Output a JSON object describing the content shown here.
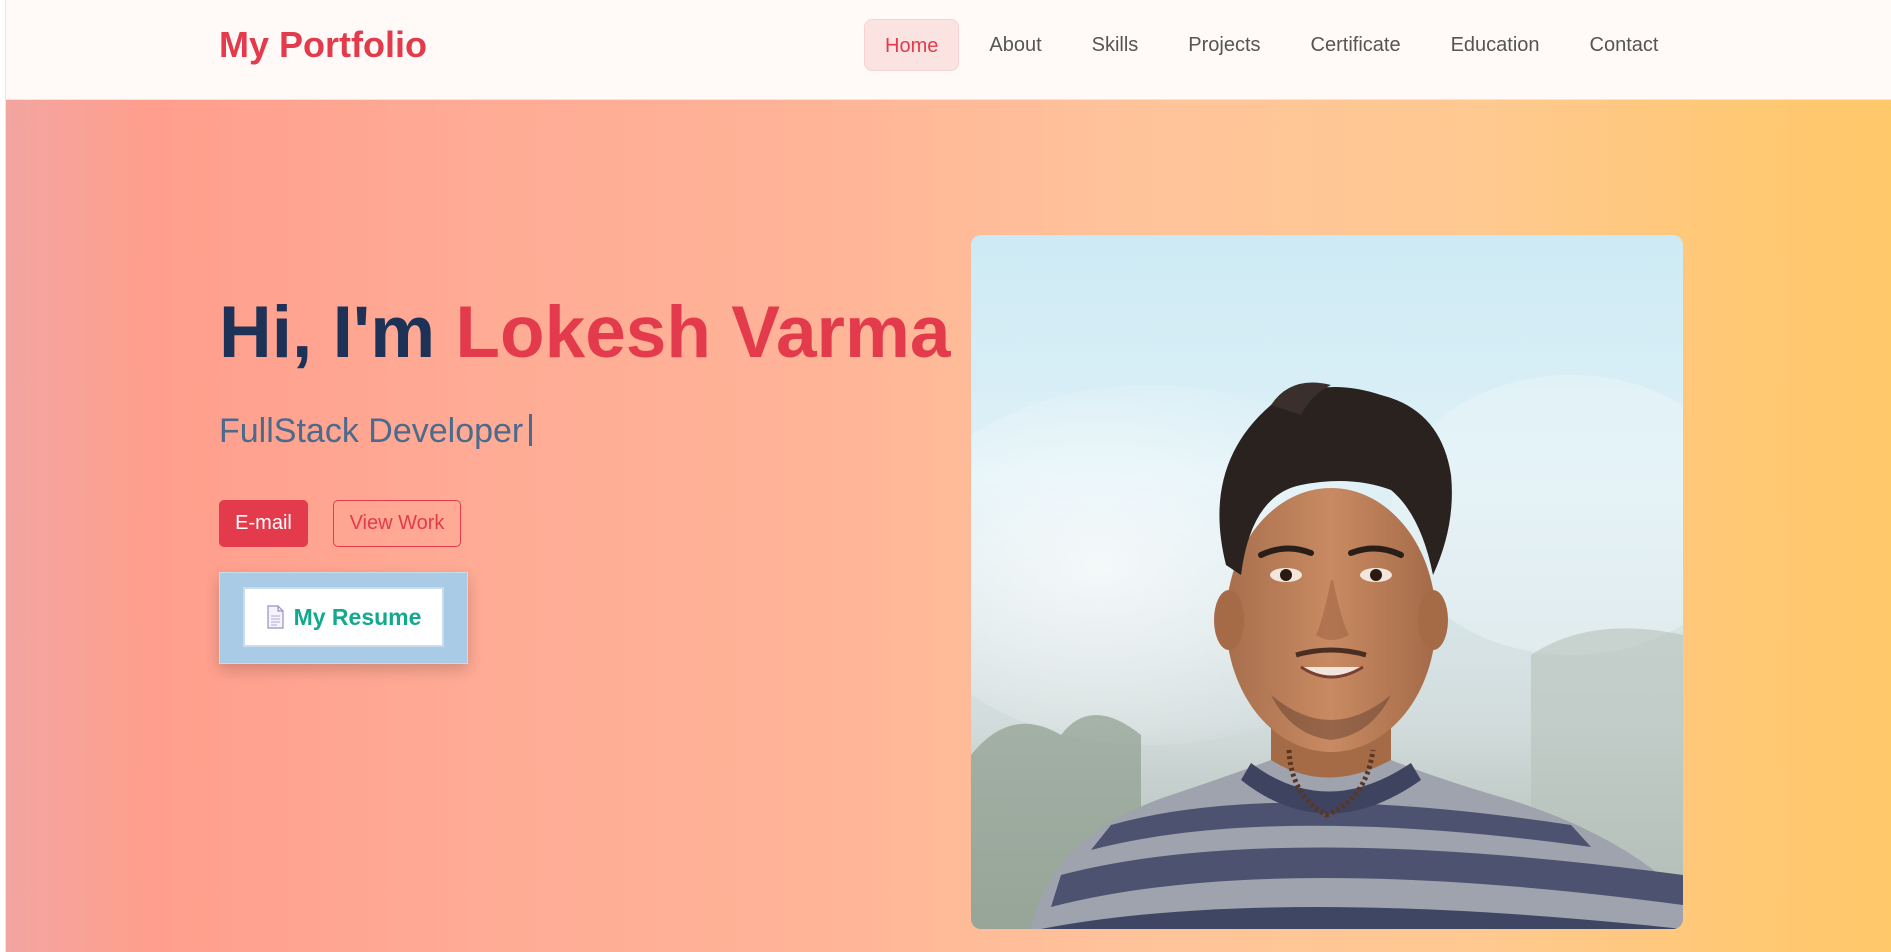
{
  "navbar": {
    "brand": "My Portfolio",
    "items": [
      {
        "label": "Home",
        "active": true
      },
      {
        "label": "About",
        "active": false
      },
      {
        "label": "Skills",
        "active": false
      },
      {
        "label": "Projects",
        "active": false
      },
      {
        "label": "Certificate",
        "active": false
      },
      {
        "label": "Education",
        "active": false
      },
      {
        "label": "Contact",
        "active": false
      }
    ]
  },
  "hero": {
    "greeting": "Hi, I'm",
    "name": "Lokesh Varma",
    "subtitle": "FullStack Developer",
    "email_button": "E-mail",
    "view_work_button": "View Work",
    "resume_button": "My Resume",
    "resume_icon": "document-icon"
  },
  "colors": {
    "accent": "#e33b4c",
    "heading": "#1e3257",
    "subtitle": "#4b6a8c",
    "resume_text": "#13a98f"
  }
}
